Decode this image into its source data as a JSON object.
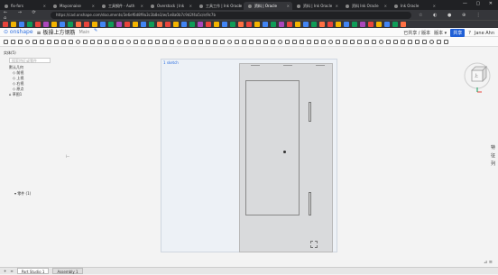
{
  "browser": {
    "tabs": [
      {
        "label": "fix-fors",
        "active": false
      },
      {
        "label": "Mayonnaise",
        "active": false
      },
      {
        "label": "工具钢件 - Auth",
        "active": false
      },
      {
        "label": "Overstock | Ink",
        "active": false
      },
      {
        "label": "工具工作 | Ink Oracle",
        "active": false
      },
      {
        "label": "资料 | Oracle",
        "active": true
      },
      {
        "label": "资料 | Ink Oracle",
        "active": false
      },
      {
        "label": "资料 Ink Oracle",
        "active": false
      },
      {
        "label": "Ink Oracle",
        "active": false
      }
    ],
    "nav_icons": "← → ⟳ ⌂",
    "url": "https://cad.onshape.com/documents/3e6ef6d8f9a3c3b8e3/w/1e8a0b7c9d2f4a5c/e/9c7b",
    "ext_icons": "☆ ◐ ● ⊕ ⋮"
  },
  "bookmark_colors": [
    "#e8453c",
    "#f4b400",
    "#4285f4",
    "#0f9d58",
    "#e8453c",
    "#ab47bc",
    "#f4b400",
    "#4285f4",
    "#0f9d58",
    "#ff7043",
    "#e8453c",
    "#f4b400",
    "#4285f4",
    "#0f9d58",
    "#ab47bc",
    "#e8453c",
    "#f4b400",
    "#4285f4",
    "#0f9d58",
    "#ff7043",
    "#e8453c",
    "#f4b400",
    "#4285f4",
    "#0f9d58",
    "#ab47bc",
    "#e8453c",
    "#f4b400",
    "#4285f4",
    "#0f9d58",
    "#ff7043",
    "#e8453c",
    "#f4b400",
    "#4285f4",
    "#0f9d58",
    "#ab47bc",
    "#e8453c",
    "#f4b400",
    "#4285f4",
    "#0f9d58",
    "#ff7043",
    "#e8453c",
    "#f4b400",
    "#4285f4",
    "#0f9d58",
    "#ab47bc",
    "#e8453c",
    "#f4b400",
    "#4285f4",
    "#0f9d58",
    "#ff7043"
  ],
  "app": {
    "logo": "⊙ onshape",
    "doc_title": "≡ 板操上方钢筋",
    "doc_meta": "Main",
    "right": {
      "share_status": "已共享 / 版本",
      "versions": "版本 ▾",
      "share": "共享",
      "help": "?",
      "user": "Jane Ahn"
    }
  },
  "feature_panel": {
    "filter_label": "实体(5)",
    "search_placeholder": "搜索特征或零件",
    "tree": [
      "默认几何",
      "◇ 前视",
      "◇ 上视",
      "◇ 右视",
      "◇ 原点",
      "⌂ 草图1"
    ],
    "parts_label": "▾ 零件 (1)"
  },
  "canvas": {
    "label": "1 sketch",
    "side_label": "|"
  },
  "nav_cube": {
    "face_label": "上"
  },
  "right_panel": {
    "items": [
      "特",
      "征",
      "列"
    ]
  },
  "bottom_bar": {
    "add_icon": "+",
    "menu_icon": "≡",
    "tabs": [
      {
        "label": "Part Studio 1",
        "active": true
      },
      {
        "label": "Assembly 1",
        "active": false
      }
    ]
  },
  "bottom_right": "⊿ ≡"
}
